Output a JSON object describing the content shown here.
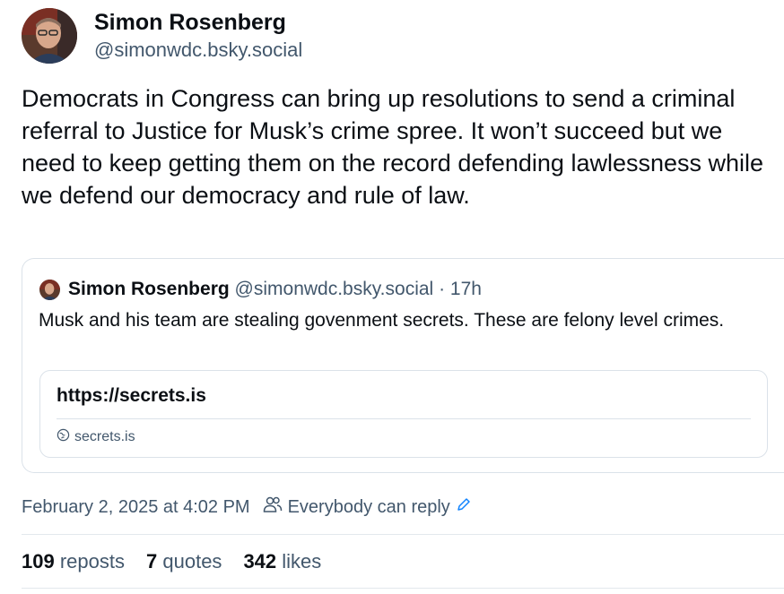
{
  "post": {
    "author_name": "Simon Rosenberg",
    "author_handle": "@simonwdc.bsky.social",
    "text": "Democrats in Congress can bring up resolutions to send a criminal referral to Justice for Musk’s crime spree.  It won’t succeed but we need to keep getting them on the record defending lawlessness while we defend our democracy and rule of law.",
    "timestamp": "February 2, 2025 at 4:02 PM",
    "reply_setting": "Everybody can reply"
  },
  "quote": {
    "author_name": "Simon Rosenberg",
    "author_handle": "@simonwdc.bsky.social",
    "separator": "·",
    "time": "17h",
    "text": "Musk and his team are stealing govenment secrets.  These are felony level crimes.",
    "link": {
      "url": "https://secrets.is",
      "domain": "secrets.is"
    }
  },
  "stats": {
    "reposts_count": "109",
    "reposts_label": "reposts",
    "quotes_count": "7",
    "quotes_label": "quotes",
    "likes_count": "342",
    "likes_label": "likes"
  },
  "icons": {
    "avatar": "avatar-photo",
    "globe": "globe-icon",
    "people": "people-icon",
    "edit": "pencil-icon"
  },
  "colors": {
    "text": "#0b0f14",
    "muted": "#42576c",
    "accent": "#1083fe",
    "border": "#dbe2e9"
  }
}
